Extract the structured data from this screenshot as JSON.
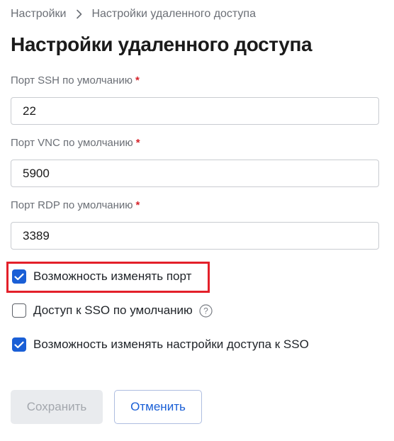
{
  "breadcrumb": {
    "items": [
      "Настройки",
      "Настройки удаленного доступа"
    ]
  },
  "page": {
    "title": "Настройки удаленного доступа"
  },
  "form": {
    "ssh": {
      "label": "Порт SSH по умолчанию",
      "required_mark": "*",
      "value": "22"
    },
    "vnc": {
      "label": "Порт VNC по умолчанию",
      "required_mark": "*",
      "value": "5900"
    },
    "rdp": {
      "label": "Порт RDP по умолчанию",
      "required_mark": "*",
      "value": "3389"
    },
    "checkboxes": [
      {
        "label": "Возможность изменять порт",
        "checked": true,
        "highlighted": true
      },
      {
        "label": "Доступ к SSO по умолчанию",
        "checked": false,
        "help_icon": "question-circle-icon"
      },
      {
        "label": "Возможность изменять настройки доступа к SSO",
        "checked": true
      }
    ]
  },
  "actions": {
    "save_label": "Сохранить",
    "save_disabled": true,
    "cancel_label": "Отменить"
  },
  "colors": {
    "accent": "#1a5fd6",
    "required": "#d6242b",
    "highlight_frame": "#e3202a",
    "muted_text": "#6b6f76",
    "disabled_bg": "#e9ebee",
    "disabled_text": "#a3a7ad"
  }
}
